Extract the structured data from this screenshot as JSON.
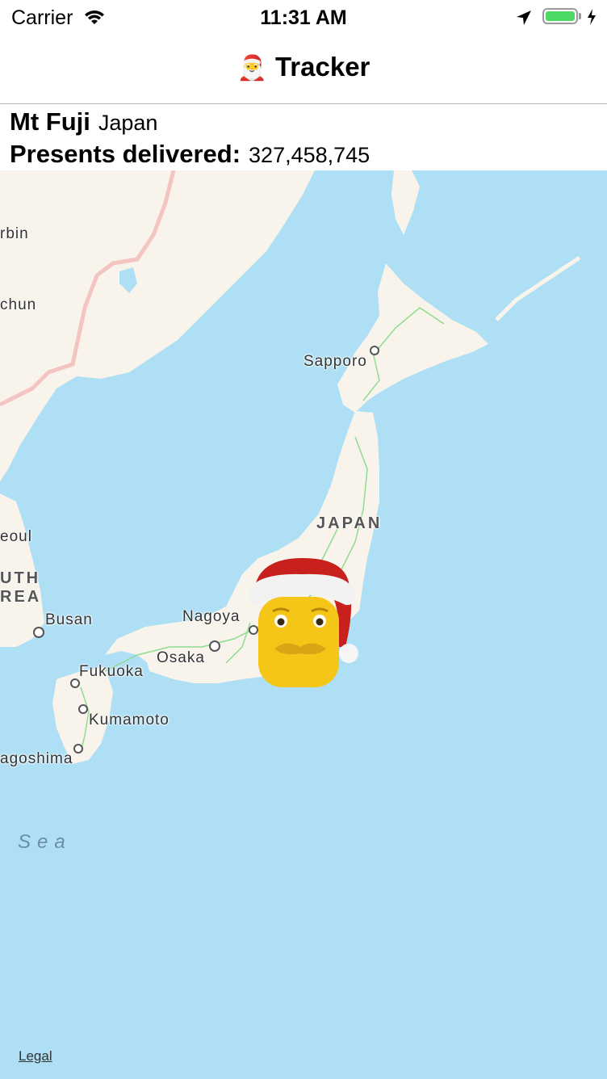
{
  "status_bar": {
    "carrier": "Carrier",
    "time": "11:31 AM",
    "wifi_icon": "wifi-icon",
    "location_icon": "location-arrow-icon",
    "battery_icon": "battery-charging-icon",
    "battery_color": "#4cd964"
  },
  "nav": {
    "title_emoji": "🎅",
    "title": "Tracker"
  },
  "info": {
    "place": "Mt Fuji",
    "country": "Japan",
    "presents_label": "Presents delivered:",
    "presents_count": "327,458,745"
  },
  "map": {
    "water_color": "#aedff5",
    "land_color": "#f8f4ec",
    "labels": {
      "harbin": "rbin",
      "changchun": "chun",
      "sapporo": "Sapporo",
      "japan": "JAPAN",
      "seoul": "eoul",
      "south_korea_1": "UTH",
      "south_korea_2": "REA",
      "busan": "Busan",
      "nagoya": "Nagoya",
      "osaka": "Osaka",
      "fukuoka": "Fukuoka",
      "kumamoto": "Kumamoto",
      "kagoshima": "agoshima",
      "sea": "Sea",
      "legal": "Legal"
    },
    "santa_pin_icon": "santa-claus-icon"
  }
}
